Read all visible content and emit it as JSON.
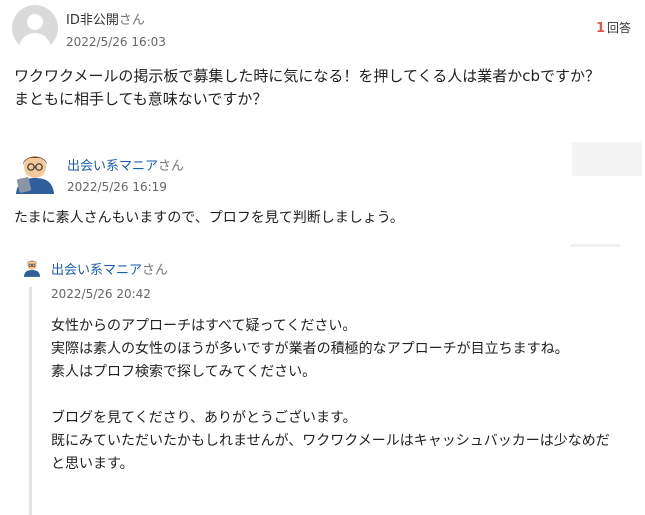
{
  "question": {
    "author_name": "ID非公開",
    "honorific": "さん",
    "date": "2022/5/26 16:03",
    "answer_count": "1",
    "answer_label": "回答",
    "body": "ワクワクメールの掲示板で募集した時に気になる！を押してくる人は業者かcbですか？\nまともに相手しても意味ないですか？"
  },
  "answer": {
    "author_name": "出会い系マニア",
    "honorific": "さん",
    "date": "2022/5/26 16:19",
    "body": "たまに素人さんもいますので、プロフを見て判断しましょう。"
  },
  "reply": {
    "author_name": "出会い系マニア",
    "honorific": "さん",
    "date": "2022/5/26 20:42",
    "body": "女性からのアプローチはすべて疑ってください。\n実際は素人の女性のほうが多いですが業者の積極的なアプローチが目立ちますね。\n素人はプロフ検索で探してみてください。\n\nブログを見てくださり、ありがとうございます。\n既にみていただいたかもしれませんが、ワクワクメールはキャッシュバッカーは少なめだと思います。"
  },
  "icons": {
    "question_avatar": "default-user-avatar-icon",
    "answer_avatar": "cartoon-man-with-tablet-avatar-icon"
  },
  "colors": {
    "link": "#1a5fb4",
    "answer_count": "#e6554a"
  }
}
